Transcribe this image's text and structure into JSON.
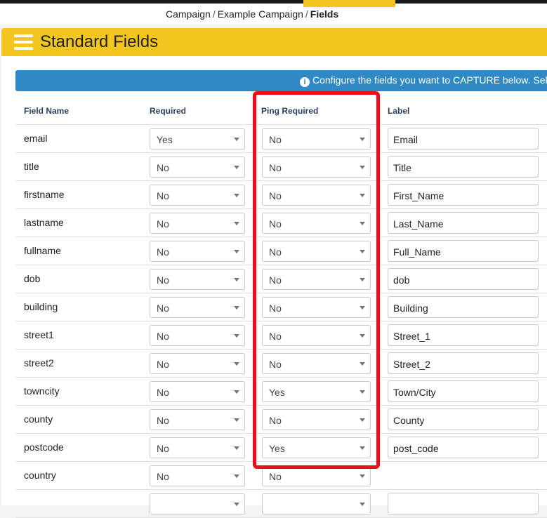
{
  "breadcrumb": {
    "part1": "Campaign",
    "sep1": "/",
    "part2": "Example Campaign",
    "sep2": "/",
    "current": "Fields"
  },
  "header": {
    "menu_icon": "hamburger-icon",
    "title": "Standard Fields"
  },
  "info": {
    "icon": "info-icon",
    "icon_glyph": "i",
    "text": "Configure the fields you want to CAPTURE below. Select o"
  },
  "table": {
    "headers": {
      "field_name": "Field Name",
      "required": "Required",
      "ping_required": "Ping Required",
      "label": "Label"
    },
    "rows": [
      {
        "field": "email",
        "required": "Yes",
        "ping": "No",
        "label": "Email"
      },
      {
        "field": "title",
        "required": "No",
        "ping": "No",
        "label": "Title"
      },
      {
        "field": "firstname",
        "required": "No",
        "ping": "No",
        "label": "First_Name"
      },
      {
        "field": "lastname",
        "required": "No",
        "ping": "No",
        "label": "Last_Name"
      },
      {
        "field": "fullname",
        "required": "No",
        "ping": "No",
        "label": "Full_Name"
      },
      {
        "field": "dob",
        "required": "No",
        "ping": "No",
        "label": "dob"
      },
      {
        "field": "building",
        "required": "No",
        "ping": "No",
        "label": "Building"
      },
      {
        "field": "street1",
        "required": "No",
        "ping": "No",
        "label": "Street_1"
      },
      {
        "field": "street2",
        "required": "No",
        "ping": "No",
        "label": "Street_2"
      },
      {
        "field": "towncity",
        "required": "No",
        "ping": "Yes",
        "label": "Town/City"
      },
      {
        "field": "county",
        "required": "No",
        "ping": "No",
        "label": "County"
      },
      {
        "field": "postcode",
        "required": "No",
        "ping": "Yes",
        "label": "post_code"
      },
      {
        "field": "country",
        "required": "No",
        "ping": "No",
        "label": null
      },
      {
        "field": "",
        "required": "",
        "ping": "",
        "label": ""
      }
    ]
  },
  "colors": {
    "brand_yellow": "#f2c61f",
    "info_blue": "#2e89c5",
    "highlight_red": "#e8101e"
  }
}
